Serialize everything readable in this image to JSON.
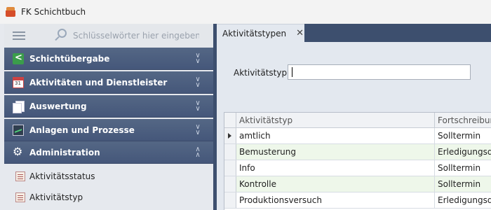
{
  "window": {
    "title": "FK Schichtbuch",
    "icon": "app-icon"
  },
  "search": {
    "placeholder": "Schlüsselwörter hier eingeben"
  },
  "sidebar": {
    "groups": [
      {
        "label": "Schichtübergabe",
        "icon": "share-icon",
        "state": "collapsed"
      },
      {
        "label": "Aktivitäten und Dienstleister",
        "icon": "calendar-icon",
        "state": "collapsed"
      },
      {
        "label": "Auswertung",
        "icon": "pages-icon",
        "state": "collapsed"
      },
      {
        "label": "Anlagen und Prozesse",
        "icon": "monitor-icon",
        "state": "collapsed"
      },
      {
        "label": "Administration",
        "icon": "gear-icon",
        "state": "expanded"
      }
    ],
    "items": [
      {
        "label": "Aktivitätsstatus",
        "icon": "list-icon"
      },
      {
        "label": "Aktivitätstyp",
        "icon": "list-icon"
      }
    ],
    "chevrons": {
      "collapsed": "⌄⌄",
      "expanded": "⌃⌃"
    }
  },
  "tab": {
    "label": "Aktivitätstypen",
    "close": "✕"
  },
  "filter": {
    "label": "Aktivitätstyp:",
    "value": ""
  },
  "grid": {
    "columns": [
      "Aktivitätstyp",
      "Fortschreibung"
    ],
    "rows": [
      [
        "amtlich",
        "Solltermin"
      ],
      [
        "Bemusterung",
        "Erledigungsdatum"
      ],
      [
        "Info",
        "Solltermin"
      ],
      [
        "Kontrolle",
        "Solltermin"
      ],
      [
        "Produktionsversuch",
        "Erledigungsdatum"
      ]
    ],
    "selected_row": 0
  }
}
